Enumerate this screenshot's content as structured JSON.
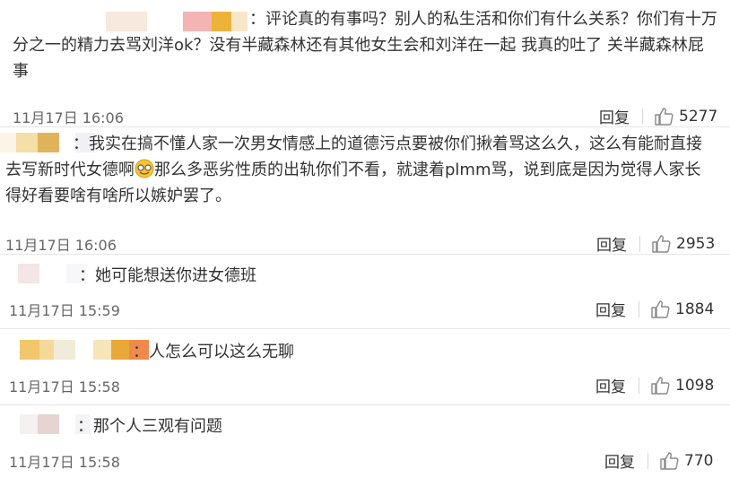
{
  "comments": [
    {
      "text_lines": [
        "：评论真的有事吗？别人的私生活和你们有什么关系？你们有十万",
        "分之一的精力去骂刘洋ok？没有半藏森林还有其他女生会和刘洋在一起 我真的吐了 关半藏森林屁",
        "事"
      ],
      "time": "11月17日 16:06",
      "reply_label": "回复",
      "likes": "5277"
    },
    {
      "text_lines": [
        "：我实在搞不懂人家一次男女情感上的道德污点要被你们揪着骂这么久，这么有能耐直接",
        "去写新时代女德啊",
        "那么多恶劣性质的出轨你们不看，就逮着plmm骂，说到底是因为觉得人家长",
        "得好看要啥有啥所以嫉妒罢了。"
      ],
      "time": "11月17日 16:06",
      "reply_label": "回复",
      "likes": "2953"
    },
    {
      "text_lines": [
        "：她可能想送你进女德班"
      ],
      "time": "11月17日 15:59",
      "reply_label": "回复",
      "likes": "1884"
    },
    {
      "text_lines": [
        "：人怎么可以这么无聊"
      ],
      "time": "11月17日 15:58",
      "reply_label": "回复",
      "likes": "1098"
    },
    {
      "text_lines": [
        "：那个人三观有问题"
      ],
      "time": "11月17日 15:58",
      "reply_label": "回复",
      "likes": "770"
    }
  ],
  "icons": {
    "like": "thumbs-up-icon",
    "emoji": "grinning-emoji-icon"
  },
  "colors": {
    "text": "#333333",
    "meta": "#666666",
    "divider": "#e6e6e6"
  }
}
